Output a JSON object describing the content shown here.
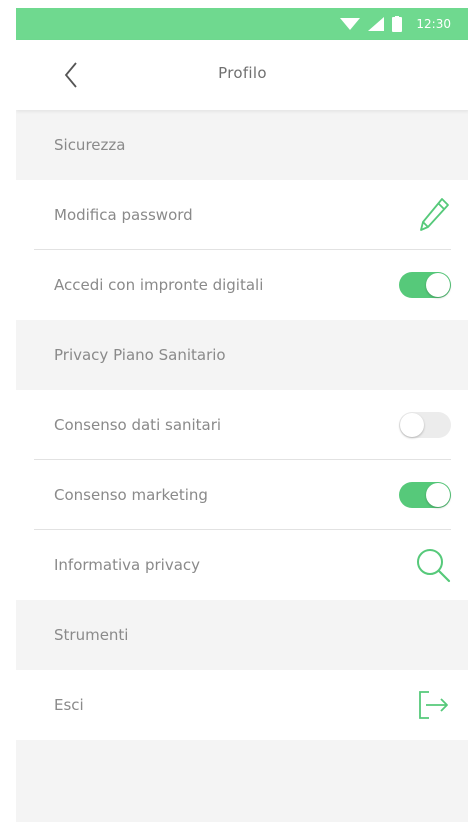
{
  "status_bar": {
    "time": "12:30"
  },
  "header": {
    "title": "Profilo",
    "back_icon": "chevron-left-icon"
  },
  "sections": [
    {
      "header": "Sicurezza"
    },
    {
      "header": "Privacy Piano Sanitario"
    },
    {
      "header": "Strumenti"
    }
  ],
  "rows": {
    "change_password": {
      "label": "Modifica password",
      "icon": "pencil-icon"
    },
    "fingerprint_login": {
      "label": "Accedi con impronte digitali",
      "enabled": true
    },
    "health_data_consent": {
      "label": "Consenso dati sanitari",
      "enabled": false
    },
    "marketing_consent": {
      "label": "Consenso marketing",
      "enabled": true
    },
    "privacy_policy": {
      "label": "Informativa privacy",
      "icon": "search-icon"
    },
    "logout": {
      "label": "Esci",
      "icon": "logout-icon"
    }
  },
  "colors": {
    "accent": "#56c97a",
    "status_bar": "#6fd98f",
    "text": "#8a8a8a",
    "section_bg": "#f4f4f4"
  }
}
